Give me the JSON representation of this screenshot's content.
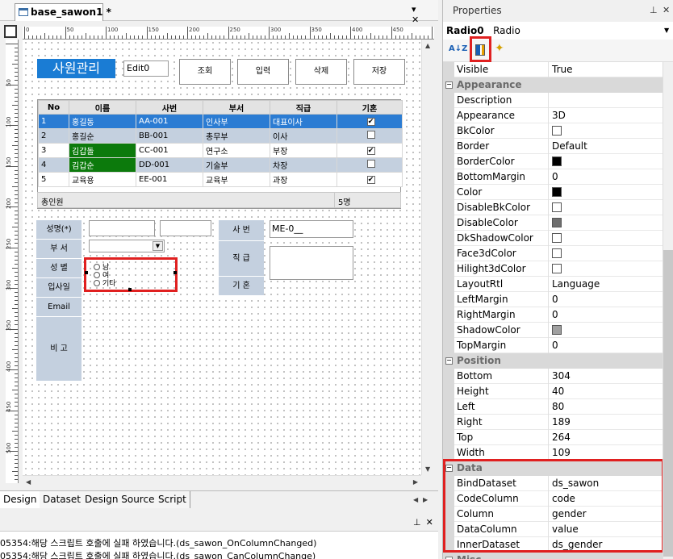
{
  "designer": {
    "tab_title": "base_sawon1 *",
    "tab_controls": "▾ ✕",
    "ruler_labels": [
      "0",
      "50",
      "100",
      "150",
      "200",
      "250",
      "300",
      "350",
      "400",
      "450"
    ],
    "vruler_labels": [
      "50",
      "100",
      "150",
      "200",
      "250",
      "300",
      "350",
      "400",
      "450",
      "500"
    ]
  },
  "form": {
    "title": "사원관리",
    "edit0_value": "Edit0",
    "buttons": [
      "조회",
      "입력",
      "삭제",
      "저장"
    ],
    "grid": {
      "headers": [
        "No",
        "이름",
        "사번",
        "부서",
        "직급",
        "기혼"
      ],
      "rows": [
        {
          "no": "1",
          "name": "홍길동",
          "id": "AA-001",
          "dept": "인사부",
          "rank": "대표이사",
          "married": true
        },
        {
          "no": "2",
          "name": "홍길순",
          "id": "BB-001",
          "dept": "총무부",
          "rank": "이사",
          "married": false
        },
        {
          "no": "3",
          "name": "김갑돌",
          "id": "CC-001",
          "dept": "연구소",
          "rank": "부장",
          "married": true
        },
        {
          "no": "4",
          "name": "김갑순",
          "id": "DD-001",
          "dept": "기술부",
          "rank": "차장",
          "married": false
        },
        {
          "no": "5",
          "name": "교육용",
          "id": "EE-001",
          "dept": "교육부",
          "rank": "과장",
          "married": true
        }
      ],
      "footer_label": "총인원",
      "footer_count": "5명"
    },
    "labels": {
      "name": "성명(*)",
      "dept": "부 서",
      "gender": "성 별",
      "hire_date": "입사일",
      "email": "Email",
      "note": "비 고",
      "emp_no": "사 번",
      "rank": "직 급",
      "married": "기 혼"
    },
    "emp_no_value": "ME-0__",
    "radio_options": [
      "남",
      "여",
      "기타"
    ]
  },
  "bottom_tabs": [
    "Design",
    "Dataset",
    "Design Source",
    "Script"
  ],
  "output": {
    "lines": [
      "05354:해당 스크립트 호출에 실패 하였습니다.(ds_sawon_OnColumnChanged)",
      "05354:해당 스크립트 호출에 실패 하였습니다.(ds_sawon_CanColumnChange)"
    ]
  },
  "properties": {
    "panel_title": "Properties",
    "object_name": "Radio0",
    "object_type": "Radio",
    "rows": [
      {
        "kind": "prop",
        "name": "Visible",
        "value": "True"
      },
      {
        "kind": "cat",
        "name": "Appearance"
      },
      {
        "kind": "prop",
        "name": "Description",
        "value": ""
      },
      {
        "kind": "prop",
        "name": "Appearance",
        "value": "3D"
      },
      {
        "kind": "prop",
        "name": "BkColor",
        "value": "",
        "swatch": "#ffffff"
      },
      {
        "kind": "prop",
        "name": "Border",
        "value": "Default"
      },
      {
        "kind": "prop",
        "name": "BorderColor",
        "value": "",
        "swatch": "#000000"
      },
      {
        "kind": "prop",
        "name": "BottomMargin",
        "value": "0"
      },
      {
        "kind": "prop",
        "name": "Color",
        "value": "",
        "swatch": "#000000"
      },
      {
        "kind": "prop",
        "name": "DisableBkColor",
        "value": "",
        "swatch": "#ffffff"
      },
      {
        "kind": "prop",
        "name": "DisableColor",
        "value": "",
        "swatch": "#6e6e6e"
      },
      {
        "kind": "prop",
        "name": "DkShadowColor",
        "value": "",
        "swatch": "#ffffff"
      },
      {
        "kind": "prop",
        "name": "Face3dColor",
        "value": "",
        "swatch": "#ffffff"
      },
      {
        "kind": "prop",
        "name": "Hilight3dColor",
        "value": "",
        "swatch": "#ffffff"
      },
      {
        "kind": "prop",
        "name": "LayoutRtl",
        "value": "Language"
      },
      {
        "kind": "prop",
        "name": "LeftMargin",
        "value": "0"
      },
      {
        "kind": "prop",
        "name": "RightMargin",
        "value": "0"
      },
      {
        "kind": "prop",
        "name": "ShadowColor",
        "value": "",
        "swatch": "#a0a0a0"
      },
      {
        "kind": "prop",
        "name": "TopMargin",
        "value": "0"
      },
      {
        "kind": "cat",
        "name": "Position"
      },
      {
        "kind": "prop",
        "name": "Bottom",
        "value": "304"
      },
      {
        "kind": "prop",
        "name": "Height",
        "value": "40"
      },
      {
        "kind": "prop",
        "name": "Left",
        "value": "80"
      },
      {
        "kind": "prop",
        "name": "Right",
        "value": "189"
      },
      {
        "kind": "prop",
        "name": "Top",
        "value": "264"
      },
      {
        "kind": "prop",
        "name": "Width",
        "value": "109"
      },
      {
        "kind": "cat",
        "name": "Data"
      },
      {
        "kind": "prop",
        "name": "BindDataset",
        "value": "ds_sawon"
      },
      {
        "kind": "prop",
        "name": "CodeColumn",
        "value": "code"
      },
      {
        "kind": "prop",
        "name": "Column",
        "value": "gender"
      },
      {
        "kind": "prop",
        "name": "DataColumn",
        "value": "value"
      },
      {
        "kind": "prop",
        "name": "InnerDataset",
        "value": "ds_gender"
      },
      {
        "kind": "cat",
        "name": "Misc"
      }
    ]
  },
  "colors": {
    "accent": "#1a7cd4",
    "highlight": "#e02020",
    "grid_selected": "#2b7cd3",
    "grid_alt": "#c4d0df",
    "green_cell": "#0c7a0c"
  }
}
